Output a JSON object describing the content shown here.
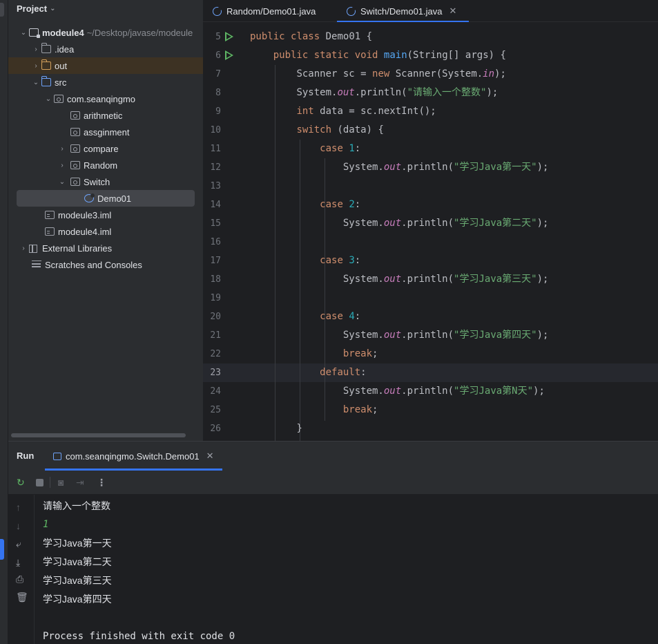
{
  "project": {
    "header": "Project",
    "tree": [
      {
        "label": "modeule4",
        "path": "~/Desktop/javase/modeule"
      },
      {
        "label": ".idea"
      },
      {
        "label": "out"
      },
      {
        "label": "src"
      },
      {
        "label": "com.seanqingmo"
      },
      {
        "label": "arithmetic"
      },
      {
        "label": "assginment"
      },
      {
        "label": "compare"
      },
      {
        "label": "Random"
      },
      {
        "label": "Switch"
      },
      {
        "label": "Demo01"
      },
      {
        "label": "modeule3.iml"
      },
      {
        "label": "modeule4.iml"
      },
      {
        "label": "External Libraries"
      },
      {
        "label": "Scratches and Consoles"
      }
    ]
  },
  "editor": {
    "tabs": [
      {
        "label": "Random/Demo01.java"
      },
      {
        "label": "Switch/Demo01.java",
        "active": true
      }
    ],
    "line_numbers": [
      "5",
      "6",
      "7",
      "8",
      "9",
      "10",
      "11",
      "12",
      "13",
      "14",
      "15",
      "16",
      "17",
      "18",
      "19",
      "20",
      "21",
      "22",
      "23",
      "24",
      "25",
      "26"
    ],
    "current_line": "23",
    "code": {
      "l5": {
        "k1": "public",
        "k2": "class",
        "t1": "Demo01 {"
      },
      "l6": {
        "k1": "public",
        "k2": "static",
        "k3": "void",
        "fn": "main",
        "t1": "(String[] args) {"
      },
      "l7": {
        "t1": "Scanner sc = ",
        "k1": "new",
        "t2": " Scanner(System.",
        "it": "in",
        "t3": ");"
      },
      "l8": {
        "t1": "System.",
        "it": "out",
        "t2": ".println(",
        "str": "\"请输入一个整数\"",
        "t3": ");"
      },
      "l9": {
        "k1": "int",
        "t1": " data = sc.nextInt();"
      },
      "l10": {
        "k1": "switch",
        "t1": " (data) {"
      },
      "l11": {
        "k1": "case",
        "num": "1",
        "t1": ":"
      },
      "l12": {
        "t1": "System.",
        "it": "out",
        "t2": ".println(",
        "str": "\"学习Java第一天\"",
        "t3": ");"
      },
      "l14": {
        "k1": "case",
        "num": "2",
        "t1": ":"
      },
      "l15": {
        "t1": "System.",
        "it": "out",
        "t2": ".println(",
        "str": "\"学习Java第二天\"",
        "t3": ");"
      },
      "l17": {
        "k1": "case",
        "num": "3",
        "t1": ":"
      },
      "l18": {
        "t1": "System.",
        "it": "out",
        "t2": ".println(",
        "str": "\"学习Java第三天\"",
        "t3": ");"
      },
      "l20": {
        "k1": "case",
        "num": "4",
        "t1": ":"
      },
      "l21": {
        "t1": "System.",
        "it": "out",
        "t2": ".println(",
        "str": "\"学习Java第四天\"",
        "t3": ");"
      },
      "l22": {
        "k1": "break",
        "t1": ";"
      },
      "l23": {
        "k1": "default",
        "t1": ":"
      },
      "l24": {
        "t1": "System.",
        "it": "out",
        "t2": ".println(",
        "str": "\"学习Java第N天\"",
        "t3": ");"
      },
      "l25": {
        "k1": "break",
        "t1": ";"
      },
      "l26": {
        "t1": "}"
      }
    }
  },
  "run": {
    "title": "Run",
    "tab_label": "com.seanqingmo.Switch.Demo01",
    "console": [
      "请输入一个整数",
      "1",
      "学习Java第一天",
      "学习Java第二天",
      "学习Java第三天",
      "学习Java第四天",
      "",
      "Process finished with exit code 0"
    ]
  },
  "icons": {
    "rerun": "rerun-icon",
    "stop": "stop-icon",
    "camera": "camera-icon",
    "exit": "exit-icon",
    "more": "more-icon",
    "up": "arrow-up-icon",
    "down": "arrow-down-icon",
    "wrap": "soft-wrap-icon",
    "scroll_end": "scroll-to-end-icon",
    "print": "print-icon",
    "trash": "trash-icon"
  },
  "colors": {
    "accent": "#3574f0",
    "keyword": "#cf8e6d",
    "function": "#56a8f5",
    "number": "#2aacb8",
    "string": "#6aab73",
    "static_field": "#c77dbb",
    "run_green": "#5fb865"
  }
}
